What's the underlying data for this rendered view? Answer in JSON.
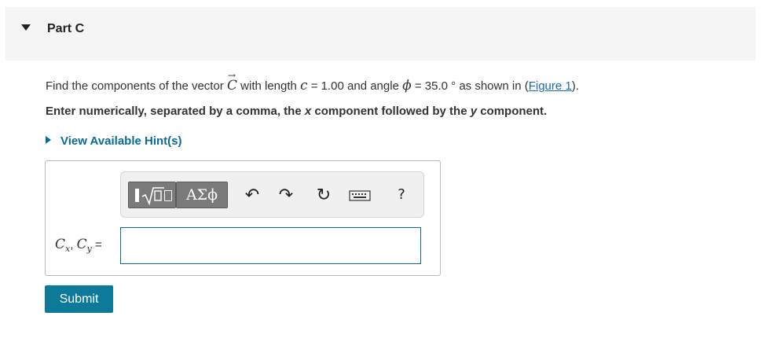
{
  "part": {
    "title": "Part C"
  },
  "question": {
    "prefix": "Find the components of the vector ",
    "vector_symbol": "C",
    "vector_arrow": "→",
    "mid1": " with length ",
    "length_var": "c",
    "length_eq": " = 1.00 and angle ",
    "angle_var": "ϕ",
    "angle_eq": " = 35.0 °",
    "suffix_before_link": "  as shown in (",
    "figure_link": "Figure 1",
    "suffix_after_link": ")."
  },
  "instruction": {
    "part1": "Enter numerically, separated by a comma, the ",
    "x": "x",
    "part2": " component followed by the ",
    "y": "y",
    "part3": " component."
  },
  "hints": {
    "label": "View Available Hint(s)"
  },
  "toolbar": {
    "greek_label": "ΑΣϕ",
    "undo_glyph": "↶",
    "redo_glyph": "↷",
    "reset_glyph": "↻",
    "help_glyph": "?"
  },
  "answer": {
    "label_cx": "C",
    "label_x_sub": "x",
    "label_sep": ", ",
    "label_cy": "C",
    "label_y_sub": "y",
    "label_eq": " =",
    "value": ""
  },
  "submit": {
    "label": "Submit"
  },
  "colors": {
    "accent": "#0d7a99",
    "link": "#1a6aa8",
    "hint": "#0d6a93",
    "header_bg": "#f5f5f5"
  }
}
